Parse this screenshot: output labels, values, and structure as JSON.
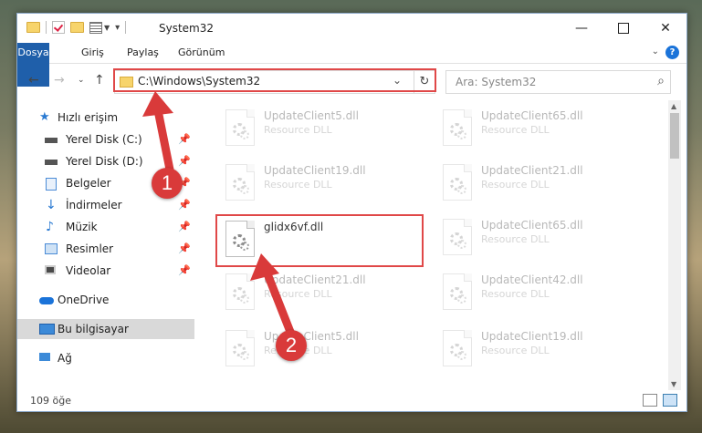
{
  "window": {
    "title": "System32",
    "min_icon": "minimize-icon",
    "max_icon": "maximize-icon",
    "close_icon": "close-icon"
  },
  "ribbon": {
    "tabs": [
      "Dosya",
      "Giriş",
      "Paylaş",
      "Görünüm"
    ],
    "help": "?"
  },
  "address": {
    "path": "C:\\Windows\\System32",
    "search_placeholder": "Ara: System32"
  },
  "sidebar": {
    "items": [
      {
        "label": "Hızlı erişim",
        "icon": "star-icon"
      },
      {
        "label": "Yerel Disk (C:)",
        "icon": "drive-icon"
      },
      {
        "label": "Yerel Disk (D:)",
        "icon": "drive-icon"
      },
      {
        "label": "Belgeler",
        "icon": "documents-icon"
      },
      {
        "label": "İndirmeler",
        "icon": "download-icon"
      },
      {
        "label": "Müzik",
        "icon": "music-icon"
      },
      {
        "label": "Resimler",
        "icon": "pictures-icon"
      },
      {
        "label": "Videolar",
        "icon": "video-icon"
      },
      {
        "label": "OneDrive",
        "icon": "cloud-icon"
      },
      {
        "label": "Bu bilgisayar",
        "icon": "computer-icon"
      },
      {
        "label": "Ağ",
        "icon": "network-icon"
      }
    ]
  },
  "files": [
    {
      "name": "UpdateClient5.dll",
      "desc": "Resource DLL"
    },
    {
      "name": "UpdateClient65.dll",
      "desc": "Resource DLL"
    },
    {
      "name": "UpdateClient19.dll",
      "desc": "Resource DLL"
    },
    {
      "name": "UpdateClient21.dll",
      "desc": "Resource DLL"
    },
    {
      "name": "glidx6vf.dll",
      "desc": ""
    },
    {
      "name": "UpdateClient65.dll",
      "desc": "Resource DLL"
    },
    {
      "name": "UpdateClient21.dll",
      "desc": "Resource DLL"
    },
    {
      "name": "UpdateClient42.dll",
      "desc": "Resource DLL"
    },
    {
      "name": "UpdateClient5.dll",
      "desc": "Resource DLL"
    },
    {
      "name": "UpdateClient19.dll",
      "desc": "Resource DLL"
    }
  ],
  "status": {
    "count": "109 öğe"
  },
  "callouts": [
    "1",
    "2"
  ],
  "colors": {
    "accent": "#1f5faa",
    "highlight": "#e04848"
  }
}
